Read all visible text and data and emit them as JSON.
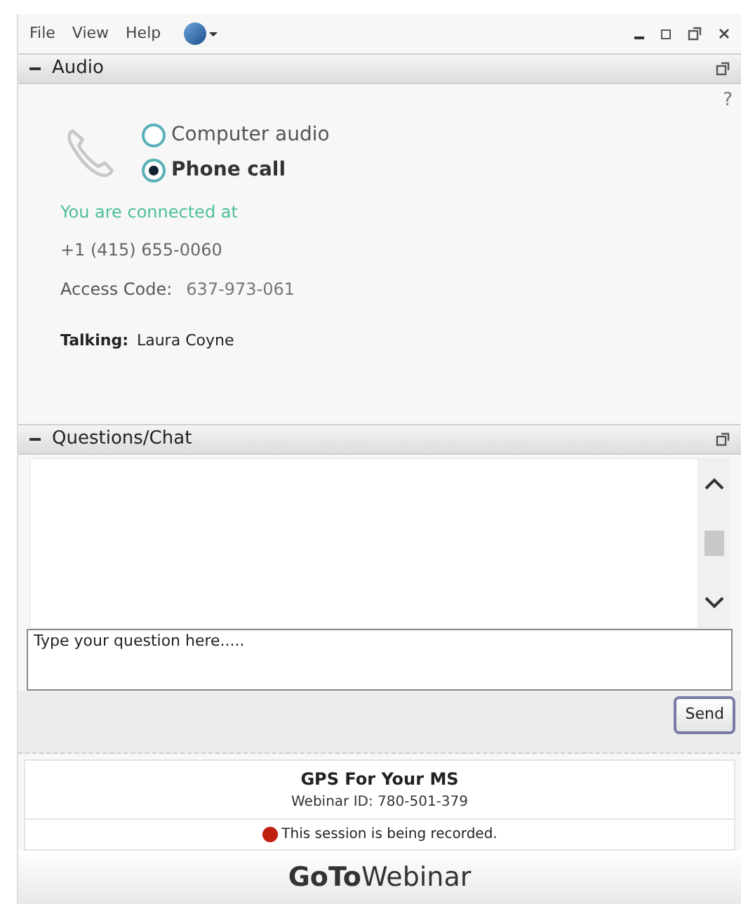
{
  "menu": [
    "File",
    "View",
    "Help"
  ],
  "audio": {
    "title": "Audio",
    "help": "?",
    "options": [
      {
        "label": "Computer audio",
        "selected": false
      },
      {
        "label": "Phone call",
        "selected": true
      }
    ],
    "status": "You are connected at",
    "phone": "+1 (415) 655-0060",
    "access_label": "Access Code:",
    "access_code": "637-973-061",
    "talking_label": "Talking:",
    "talking_name": "Laura Coyne"
  },
  "chat": {
    "title": "Questions/Chat",
    "placeholder": "Type your question here.....",
    "send": "Send"
  },
  "footer": {
    "title": "GPS For Your MS",
    "webinar_id": "Webinar ID: 780-501-379",
    "recording": "This session is being recorded.",
    "brand": "**GoTo**Webinar"
  }
}
